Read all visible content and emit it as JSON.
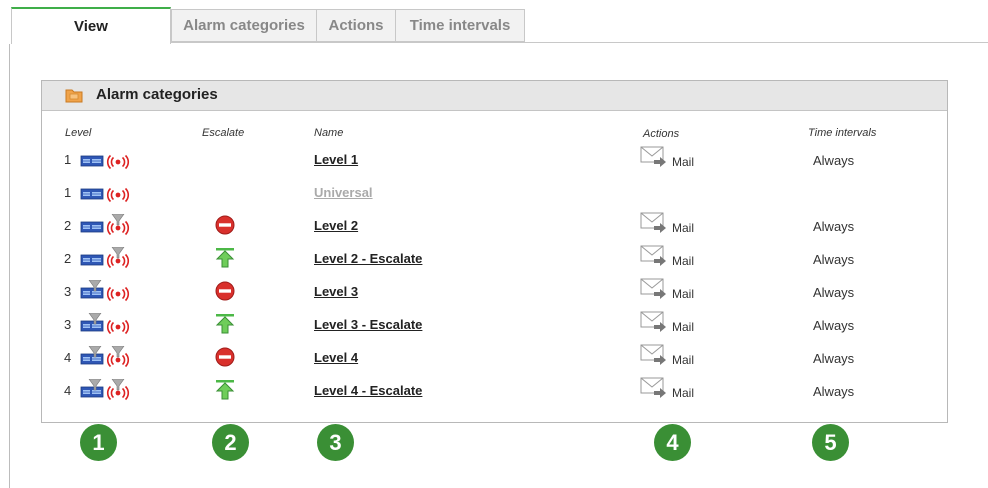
{
  "tabs": [
    {
      "label": "View",
      "active": true
    },
    {
      "label": "Alarm categories",
      "active": false
    },
    {
      "label": "Actions",
      "active": false
    },
    {
      "label": "Time intervals",
      "active": false
    }
  ],
  "panel": {
    "title": "Alarm categories",
    "columns": {
      "level": "Level",
      "escalate": "Escalate",
      "name": "Name",
      "actions": "Actions",
      "time_intervals": "Time intervals"
    },
    "rows": [
      {
        "level": "1",
        "severity_icon": "monitor-icon",
        "signal_icon": "alarm-signal-icon",
        "escalate": "",
        "name": "Level 1",
        "action": "Mail",
        "time": "Always",
        "disabled": false
      },
      {
        "level": "1",
        "severity_icon": "monitor-icon",
        "signal_icon": "alarm-signal-icon",
        "escalate": "",
        "name": "Universal",
        "action": "",
        "time": "",
        "disabled": true
      },
      {
        "level": "2",
        "severity_icon": "monitor-icon",
        "signal_icon": "filtered-signal-icon",
        "escalate": "stop-icon",
        "name": "Level 2",
        "action": "Mail",
        "time": "Always",
        "disabled": false
      },
      {
        "level": "2",
        "severity_icon": "monitor-icon",
        "signal_icon": "filtered-signal-icon",
        "escalate": "escalate-up-icon",
        "name": "Level 2 - Escalate",
        "action": "Mail",
        "time": "Always",
        "disabled": false
      },
      {
        "level": "3",
        "severity_icon": "filtered-monitor-icon",
        "signal_icon": "alarm-signal-icon",
        "escalate": "stop-icon",
        "name": "Level 3",
        "action": "Mail",
        "time": "Always",
        "disabled": false
      },
      {
        "level": "3",
        "severity_icon": "filtered-monitor-icon",
        "signal_icon": "alarm-signal-icon",
        "escalate": "escalate-up-icon",
        "name": "Level 3 - Escalate",
        "action": "Mail",
        "time": "Always",
        "disabled": false
      },
      {
        "level": "4",
        "severity_icon": "filtered-monitor-icon",
        "signal_icon": "filtered-signal-icon",
        "escalate": "stop-icon",
        "name": "Level 4",
        "action": "Mail",
        "time": "Always",
        "disabled": false
      },
      {
        "level": "4",
        "severity_icon": "filtered-monitor-icon",
        "signal_icon": "filtered-signal-icon",
        "escalate": "escalate-up-icon",
        "name": "Level 4 - Escalate",
        "action": "Mail",
        "time": "Always",
        "disabled": false
      }
    ]
  },
  "callouts": [
    "1",
    "2",
    "3",
    "4",
    "5"
  ],
  "colors": {
    "accent": "#3fae49",
    "badge": "#3a8f35",
    "stop": "#d9302c",
    "escalate": "#4cb847"
  }
}
